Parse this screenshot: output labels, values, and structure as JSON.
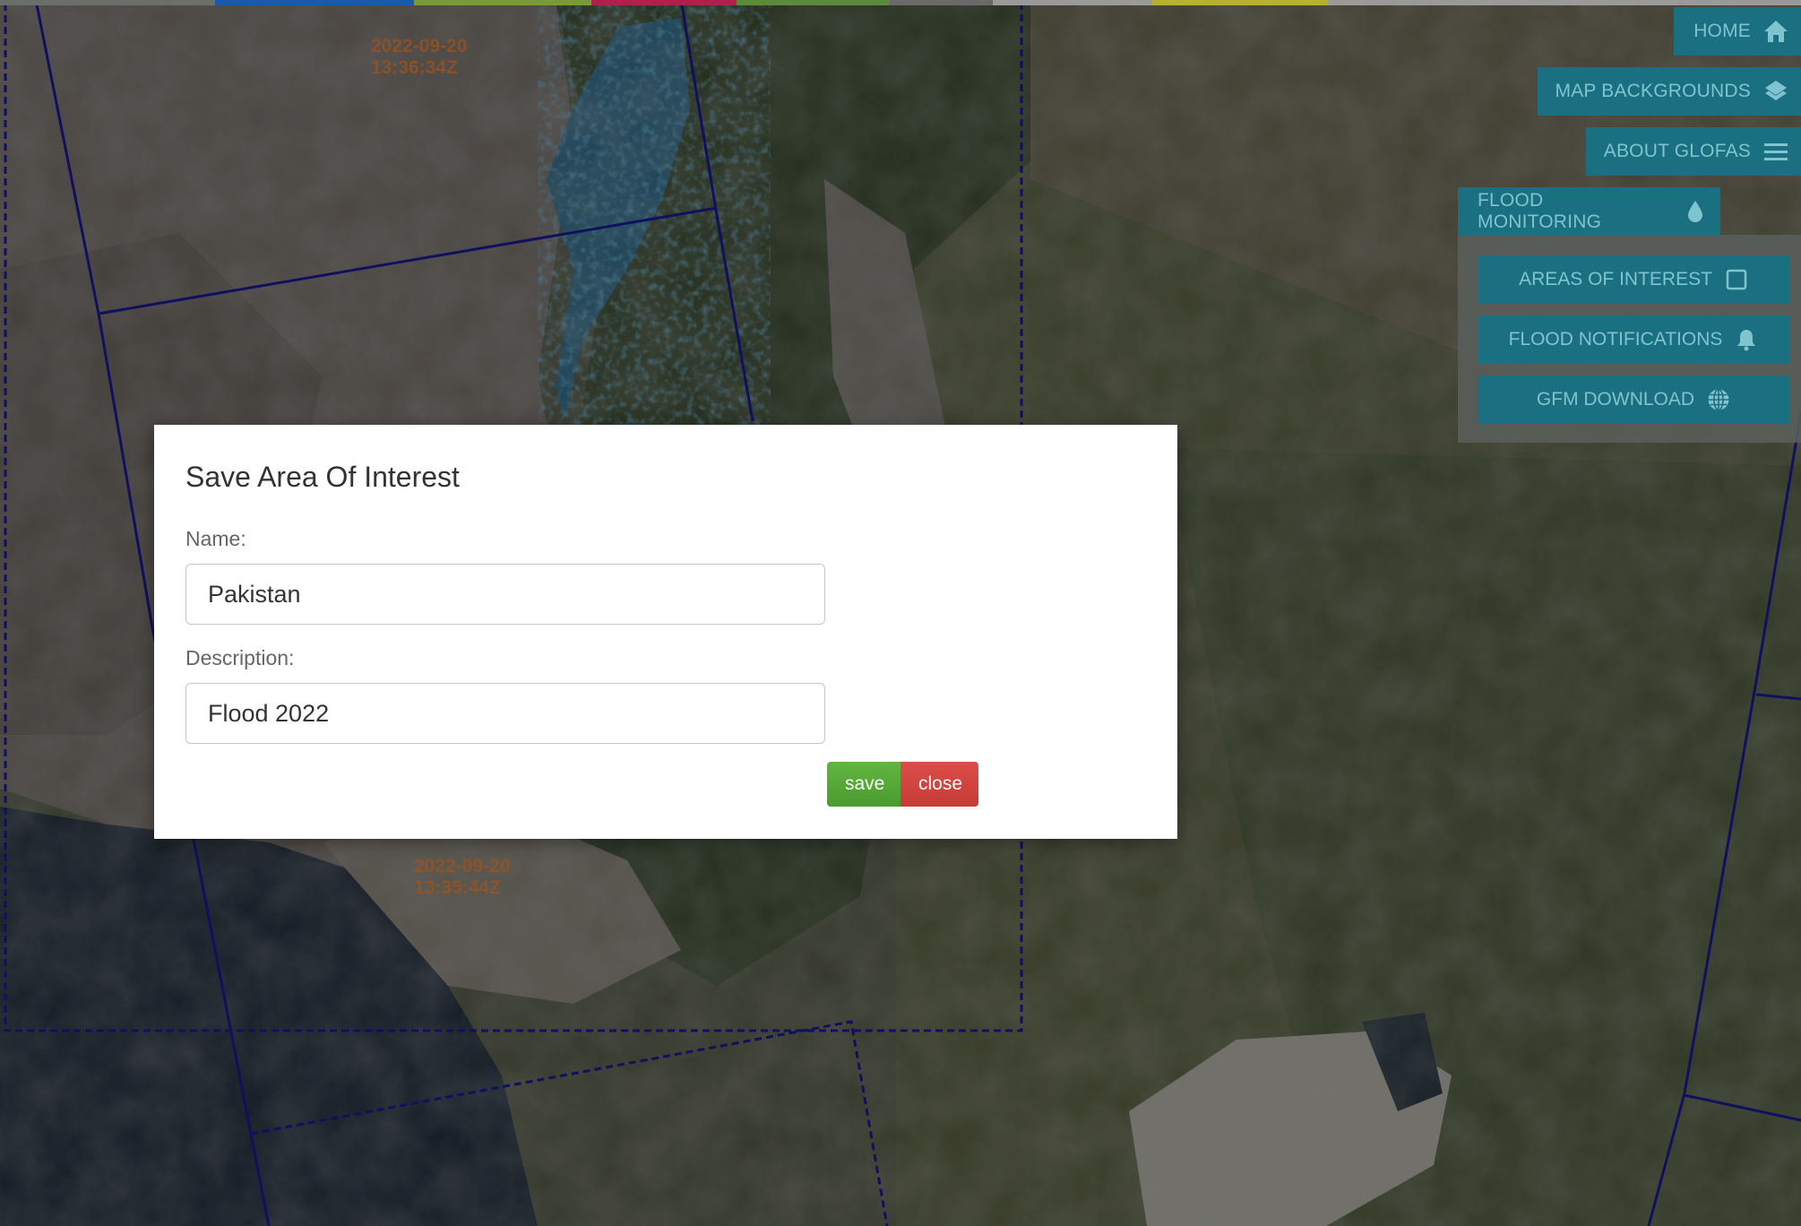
{
  "map": {
    "timestamps": [
      {
        "date": "2022-09-20",
        "time": "13:36:34Z"
      },
      {
        "date": "2022-09-20",
        "time": "13:35:44Z"
      }
    ],
    "top_strip_colors": [
      "#6b6f6a",
      "#1a5aa8",
      "#7a9a3a",
      "#b0204a",
      "#5a8a3a",
      "#6a6a6a",
      "#9a9a9a",
      "#b8b030",
      "#9a9a9a"
    ]
  },
  "menu": {
    "home": {
      "label": "HOME",
      "icon": "home-icon"
    },
    "map_backgrounds": {
      "label": "MAP BACKGROUNDS",
      "icon": "layers-icon"
    },
    "about_glofas": {
      "label": "ABOUT GLOFAS",
      "icon": "hamburger-icon"
    },
    "flood_monitoring": {
      "label": "FLOOD MONITORING",
      "icon": "drop-icon",
      "items": [
        {
          "label": "AREAS OF INTEREST",
          "icon": "square-icon"
        },
        {
          "label": "FLOOD NOTIFICATIONS",
          "icon": "bell-icon"
        },
        {
          "label": "GFM DOWNLOAD",
          "icon": "globe-icon"
        }
      ]
    }
  },
  "modal": {
    "title": "Save Area Of Interest",
    "name_label": "Name:",
    "name_value": "Pakistan",
    "description_label": "Description:",
    "description_value": "Flood 2022",
    "save_label": "save",
    "close_label": "close"
  },
  "colors": {
    "menu_bg": "#1a6f80",
    "menu_text": "#7fc4cf",
    "save": "#55a934",
    "close": "#d2423e"
  }
}
